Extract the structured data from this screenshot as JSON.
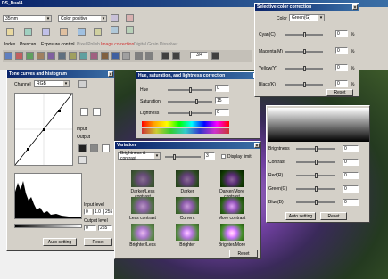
{
  "app": {
    "title": "DS_Dual4"
  },
  "toolbar": {
    "size": "35mm",
    "film": "Color positive"
  },
  "tabs": [
    "Index",
    "Prescan",
    "Exposure control",
    "Pixel Polish",
    "Image correction",
    "Digital Grain Dissolver"
  ],
  "nav": {
    "page": "3/4"
  },
  "tone": {
    "title": "Tone curves and histogram",
    "channel_label": "Channel",
    "channel": "RGB",
    "input": "Input",
    "output": "Output",
    "input_level": "Input level",
    "output_level": "Output level",
    "in_vals": [
      "0",
      "1.0",
      "255"
    ],
    "out_vals": [
      "0",
      "255"
    ],
    "auto": "Auto setting",
    "reset": "Reset"
  },
  "hue": {
    "title": "Hue, saturation, and lightness correction",
    "rows": [
      {
        "label": "Hue",
        "value": "0"
      },
      {
        "label": "Saturation",
        "value": "15"
      },
      {
        "label": "Lightness",
        "value": "0"
      }
    ]
  },
  "variation": {
    "title": "Variation",
    "mode": "Brightness & contrast",
    "step": "3",
    "display_limit": "Display limit",
    "captions": [
      "Darker/Less contrast",
      "Darker",
      "Darker/More contrast",
      "Less contrast",
      "Current",
      "More contrast",
      "Brighter/Less",
      "Brighter",
      "Brighter/More"
    ],
    "reset": "Reset"
  },
  "selective": {
    "title": "Selective color correction",
    "color_label": "Color",
    "color": "Green(G)",
    "rows": [
      {
        "label": "Cyan(C)",
        "value": "0",
        "unit": "%"
      },
      {
        "label": "Magenta(M)",
        "value": "0",
        "unit": "%"
      },
      {
        "label": "Yellow(Y)",
        "value": "0",
        "unit": "%"
      },
      {
        "label": "Black(K)",
        "value": "0",
        "unit": "%"
      }
    ],
    "reset": "Reset"
  },
  "bright": {
    "rows": [
      {
        "label": "Brightness",
        "value": "0"
      },
      {
        "label": "Contrast",
        "value": "0"
      },
      {
        "label": "Red(R)",
        "value": "0"
      },
      {
        "label": "Green(G)",
        "value": "0"
      },
      {
        "label": "Blue(B)",
        "value": "0"
      }
    ],
    "auto": "Auto setting",
    "reset": "Reset"
  },
  "side": [
    "R",
    "G",
    "B"
  ]
}
